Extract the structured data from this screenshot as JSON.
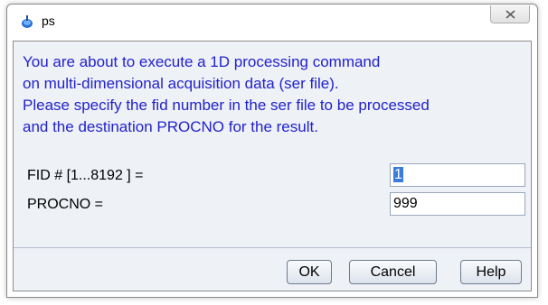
{
  "window": {
    "title": "ps",
    "close_glyph": "X"
  },
  "message": {
    "lines": [
      "You are about to execute a 1D processing command",
      "on multi-dimensional acquisition data (ser file).",
      "Please specify the fid number in the ser file to be processed",
      "and the destination PROCNO for the result."
    ]
  },
  "fields": [
    {
      "label": "FID # [1...8192 ] =",
      "value": "1"
    },
    {
      "label": "PROCNO =",
      "value": "999"
    }
  ],
  "buttons": {
    "ok": "OK",
    "cancel": "Cancel",
    "help": "Help"
  },
  "colors": {
    "message_text": "#2222cc",
    "dialog_background": "#eef1f6",
    "selection": "#3a7be0"
  },
  "icons": {
    "app": "bruker-topspin-icon",
    "close": "close-icon"
  }
}
